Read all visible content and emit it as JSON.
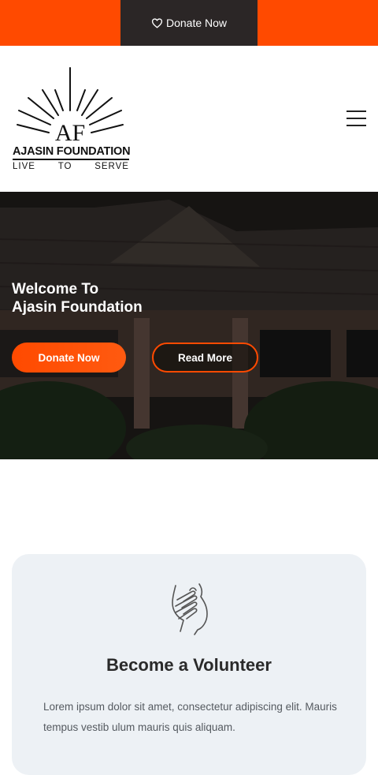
{
  "topbar": {
    "donate_label": "Donate Now",
    "icon": "heart-icon",
    "background": "#ff4a00",
    "button_background": "#2b2626"
  },
  "header": {
    "logo": {
      "monogram": "AF",
      "name": "AJASIN FOUNDATION",
      "tagline": [
        "LIVE",
        "TO",
        "SERVE"
      ]
    },
    "menu_icon": "hamburger-icon"
  },
  "hero": {
    "title_line1": "Welcome To",
    "title_line2": "Ajasin Foundation",
    "donate_label": "Donate Now",
    "read_more_label": "Read More",
    "accent": "#ff4a00"
  },
  "volunteer": {
    "icon": "helping-hands-icon",
    "title": "Become a Volunteer",
    "text": "Lorem ipsum dolor sit amet, consectetur adipiscing elit. Mauris tempus vestib ulum mauris quis aliquam."
  }
}
